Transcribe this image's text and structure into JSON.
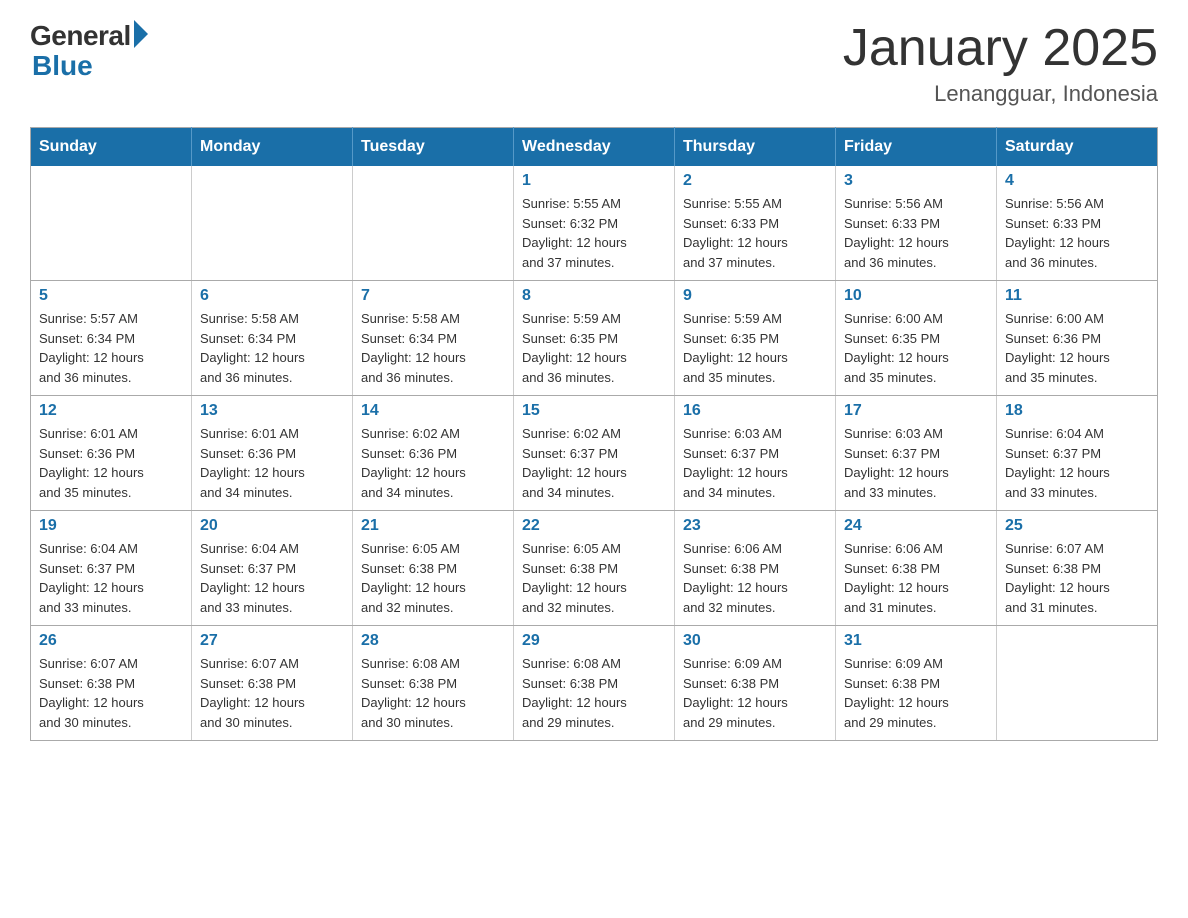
{
  "header": {
    "logo_general": "General",
    "logo_blue": "Blue",
    "month_title": "January 2025",
    "location": "Lenangguar, Indonesia"
  },
  "weekdays": [
    "Sunday",
    "Monday",
    "Tuesday",
    "Wednesday",
    "Thursday",
    "Friday",
    "Saturday"
  ],
  "weeks": [
    [
      {
        "day": "",
        "info": ""
      },
      {
        "day": "",
        "info": ""
      },
      {
        "day": "",
        "info": ""
      },
      {
        "day": "1",
        "info": "Sunrise: 5:55 AM\nSunset: 6:32 PM\nDaylight: 12 hours\nand 37 minutes."
      },
      {
        "day": "2",
        "info": "Sunrise: 5:55 AM\nSunset: 6:33 PM\nDaylight: 12 hours\nand 37 minutes."
      },
      {
        "day": "3",
        "info": "Sunrise: 5:56 AM\nSunset: 6:33 PM\nDaylight: 12 hours\nand 36 minutes."
      },
      {
        "day": "4",
        "info": "Sunrise: 5:56 AM\nSunset: 6:33 PM\nDaylight: 12 hours\nand 36 minutes."
      }
    ],
    [
      {
        "day": "5",
        "info": "Sunrise: 5:57 AM\nSunset: 6:34 PM\nDaylight: 12 hours\nand 36 minutes."
      },
      {
        "day": "6",
        "info": "Sunrise: 5:58 AM\nSunset: 6:34 PM\nDaylight: 12 hours\nand 36 minutes."
      },
      {
        "day": "7",
        "info": "Sunrise: 5:58 AM\nSunset: 6:34 PM\nDaylight: 12 hours\nand 36 minutes."
      },
      {
        "day": "8",
        "info": "Sunrise: 5:59 AM\nSunset: 6:35 PM\nDaylight: 12 hours\nand 36 minutes."
      },
      {
        "day": "9",
        "info": "Sunrise: 5:59 AM\nSunset: 6:35 PM\nDaylight: 12 hours\nand 35 minutes."
      },
      {
        "day": "10",
        "info": "Sunrise: 6:00 AM\nSunset: 6:35 PM\nDaylight: 12 hours\nand 35 minutes."
      },
      {
        "day": "11",
        "info": "Sunrise: 6:00 AM\nSunset: 6:36 PM\nDaylight: 12 hours\nand 35 minutes."
      }
    ],
    [
      {
        "day": "12",
        "info": "Sunrise: 6:01 AM\nSunset: 6:36 PM\nDaylight: 12 hours\nand 35 minutes."
      },
      {
        "day": "13",
        "info": "Sunrise: 6:01 AM\nSunset: 6:36 PM\nDaylight: 12 hours\nand 34 minutes."
      },
      {
        "day": "14",
        "info": "Sunrise: 6:02 AM\nSunset: 6:36 PM\nDaylight: 12 hours\nand 34 minutes."
      },
      {
        "day": "15",
        "info": "Sunrise: 6:02 AM\nSunset: 6:37 PM\nDaylight: 12 hours\nand 34 minutes."
      },
      {
        "day": "16",
        "info": "Sunrise: 6:03 AM\nSunset: 6:37 PM\nDaylight: 12 hours\nand 34 minutes."
      },
      {
        "day": "17",
        "info": "Sunrise: 6:03 AM\nSunset: 6:37 PM\nDaylight: 12 hours\nand 33 minutes."
      },
      {
        "day": "18",
        "info": "Sunrise: 6:04 AM\nSunset: 6:37 PM\nDaylight: 12 hours\nand 33 minutes."
      }
    ],
    [
      {
        "day": "19",
        "info": "Sunrise: 6:04 AM\nSunset: 6:37 PM\nDaylight: 12 hours\nand 33 minutes."
      },
      {
        "day": "20",
        "info": "Sunrise: 6:04 AM\nSunset: 6:37 PM\nDaylight: 12 hours\nand 33 minutes."
      },
      {
        "day": "21",
        "info": "Sunrise: 6:05 AM\nSunset: 6:38 PM\nDaylight: 12 hours\nand 32 minutes."
      },
      {
        "day": "22",
        "info": "Sunrise: 6:05 AM\nSunset: 6:38 PM\nDaylight: 12 hours\nand 32 minutes."
      },
      {
        "day": "23",
        "info": "Sunrise: 6:06 AM\nSunset: 6:38 PM\nDaylight: 12 hours\nand 32 minutes."
      },
      {
        "day": "24",
        "info": "Sunrise: 6:06 AM\nSunset: 6:38 PM\nDaylight: 12 hours\nand 31 minutes."
      },
      {
        "day": "25",
        "info": "Sunrise: 6:07 AM\nSunset: 6:38 PM\nDaylight: 12 hours\nand 31 minutes."
      }
    ],
    [
      {
        "day": "26",
        "info": "Sunrise: 6:07 AM\nSunset: 6:38 PM\nDaylight: 12 hours\nand 30 minutes."
      },
      {
        "day": "27",
        "info": "Sunrise: 6:07 AM\nSunset: 6:38 PM\nDaylight: 12 hours\nand 30 minutes."
      },
      {
        "day": "28",
        "info": "Sunrise: 6:08 AM\nSunset: 6:38 PM\nDaylight: 12 hours\nand 30 minutes."
      },
      {
        "day": "29",
        "info": "Sunrise: 6:08 AM\nSunset: 6:38 PM\nDaylight: 12 hours\nand 29 minutes."
      },
      {
        "day": "30",
        "info": "Sunrise: 6:09 AM\nSunset: 6:38 PM\nDaylight: 12 hours\nand 29 minutes."
      },
      {
        "day": "31",
        "info": "Sunrise: 6:09 AM\nSunset: 6:38 PM\nDaylight: 12 hours\nand 29 minutes."
      },
      {
        "day": "",
        "info": ""
      }
    ]
  ]
}
